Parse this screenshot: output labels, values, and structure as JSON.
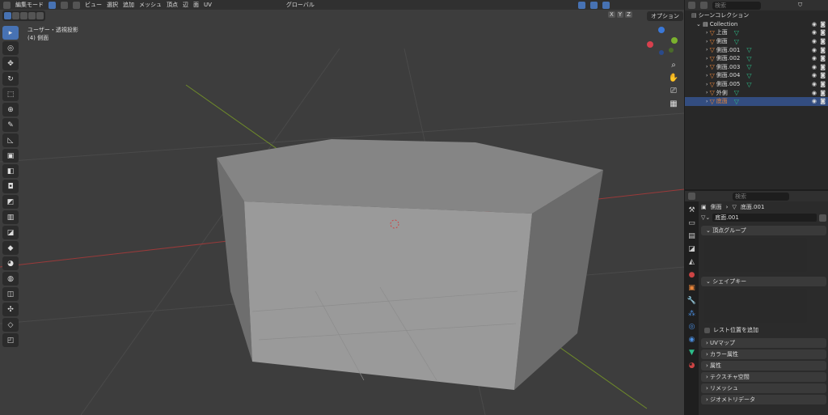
{
  "header": {
    "mode": "編集モード",
    "menus": [
      "ビュー",
      "選択",
      "追加",
      "メッシュ",
      "頂点",
      "辺",
      "面",
      "UV"
    ],
    "orientation": "グローバル",
    "options": "オプション",
    "axes": [
      "X",
      "Y",
      "Z"
    ]
  },
  "viewport": {
    "view_name": "ユーザー・透視投影",
    "object_label": "(4) 側面"
  },
  "outliner": {
    "search_placeholder": "検索",
    "scene_collection": "シーンコレクション",
    "collection": "Collection",
    "items": [
      {
        "name": "上面",
        "selected": false
      },
      {
        "name": "側面",
        "selected": false
      },
      {
        "name": "側面.001",
        "selected": false
      },
      {
        "name": "側面.002",
        "selected": false
      },
      {
        "name": "側面.003",
        "selected": false
      },
      {
        "name": "側面.004",
        "selected": false
      },
      {
        "name": "側面.005",
        "selected": false
      },
      {
        "name": "外側",
        "selected": false
      },
      {
        "name": "底面",
        "selected": true
      }
    ]
  },
  "properties": {
    "search_placeholder": "検索",
    "breadcrumb_object": "側面",
    "breadcrumb_mesh": "底面.001",
    "mesh_name": "底面.001",
    "vertex_groups": "頂点グループ",
    "shape_keys": "シェイプキー",
    "rest_position": "レスト位置を追加",
    "panels": [
      "UVマップ",
      "カラー属性",
      "属性",
      "テクスチャ空間",
      "リメッシュ",
      "ジオメトリデータ"
    ]
  },
  "colors": {
    "accent": "#4772b3",
    "selection": "#334d80",
    "object": "#e8853a",
    "mesh": "#2dbd8a"
  }
}
